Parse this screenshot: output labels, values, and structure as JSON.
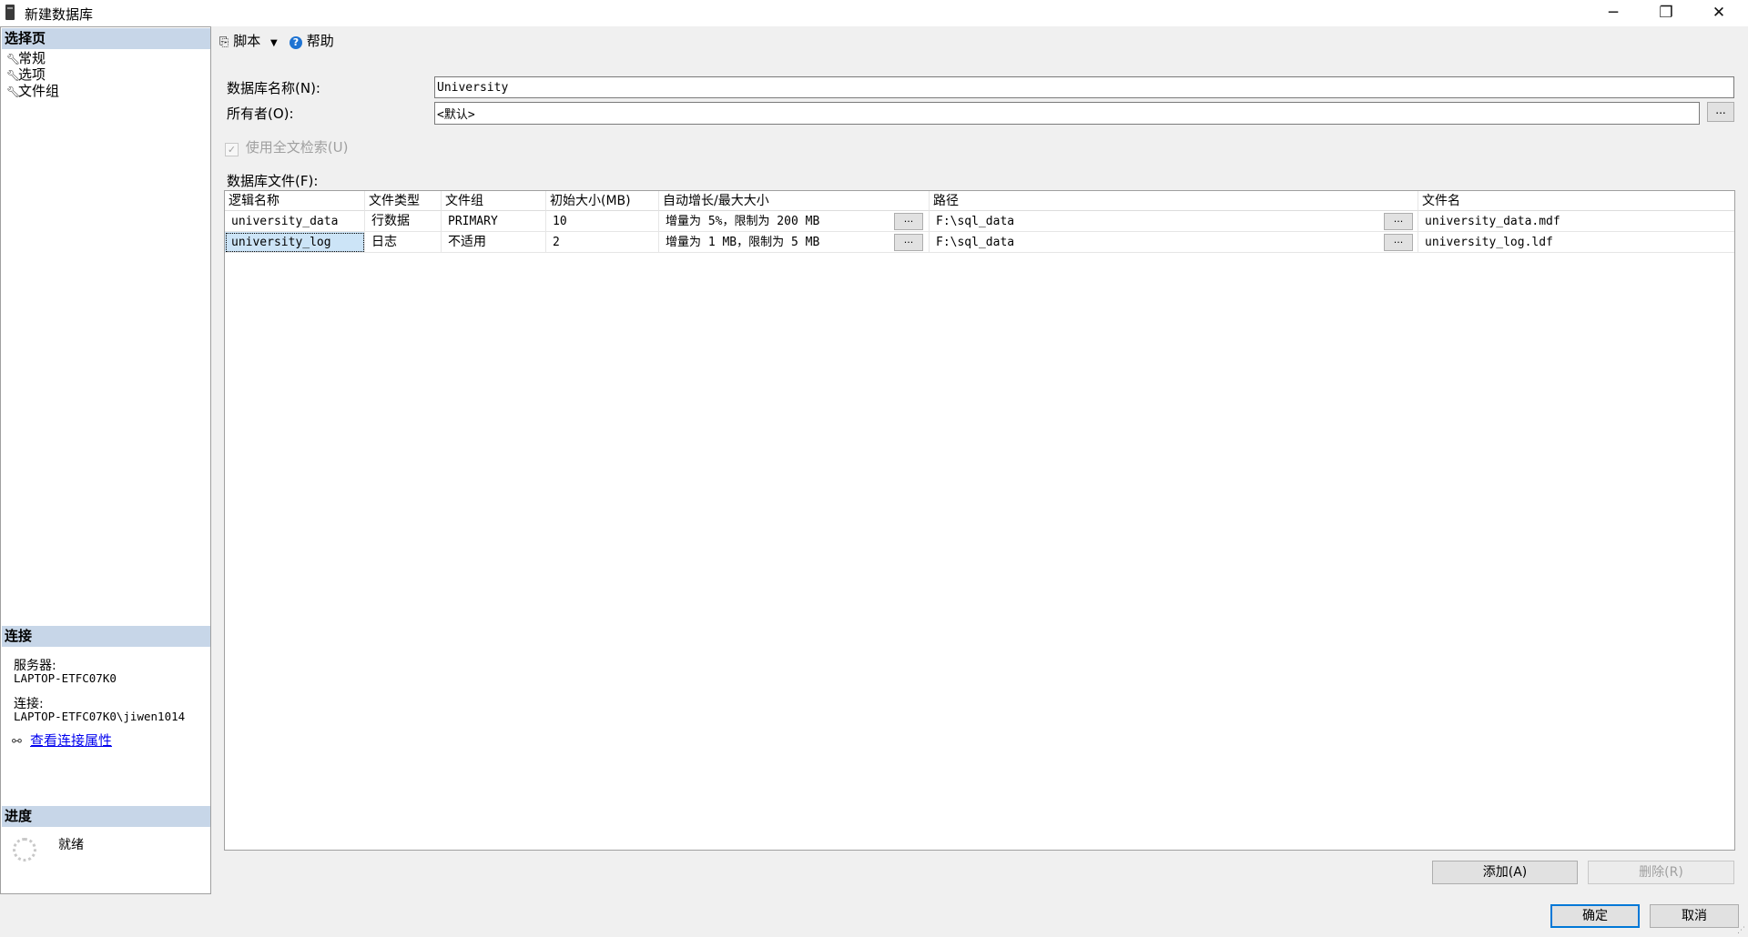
{
  "window": {
    "title": "新建数据库",
    "minimize": "─",
    "restore": "❐",
    "close": "✕"
  },
  "sidebar": {
    "select_page_header": "选择页",
    "pages": [
      {
        "label": "常规",
        "icon": "wrench-icon"
      },
      {
        "label": "选项",
        "icon": "wrench-icon"
      },
      {
        "label": "文件组",
        "icon": "wrench-icon"
      }
    ],
    "connection_header": "连接",
    "server_label": "服务器:",
    "server_value": "LAPTOP-ETFC07K0",
    "connection_label": "连接:",
    "connection_value": "LAPTOP-ETFC07K0\\jiwen1014",
    "view_properties_link": "查看连接属性",
    "progress_header": "进度",
    "progress_status": "就绪"
  },
  "toolbar": {
    "script_label": "脚本",
    "help_label": "帮助"
  },
  "form": {
    "db_name_label": "数据库名称(N):",
    "db_name_value": "University",
    "owner_label": "所有者(O):",
    "owner_value": "<默认>",
    "owner_browse": "...",
    "fulltext_label": "使用全文检索(U)",
    "fulltext_checked": true,
    "db_files_label": "数据库文件(F):"
  },
  "files_table": {
    "columns": [
      "逻辑名称",
      "文件类型",
      "文件组",
      "初始大小(MB)",
      "自动增长/最大大小",
      "路径",
      "文件名"
    ],
    "rows": [
      {
        "logical_name": "university_data",
        "file_type": "行数据",
        "filegroup": "PRIMARY",
        "initial_size": "10",
        "autogrowth": "增量为 5%，限制为 200 MB",
        "autogrowth_btn": "...",
        "path": "F:\\sql_data",
        "path_btn": "...",
        "file_name": "university_data.mdf"
      },
      {
        "logical_name": "university_log",
        "file_type": "日志",
        "filegroup": "不适用",
        "initial_size": "2",
        "autogrowth": "增量为 1 MB，限制为 5 MB",
        "autogrowth_btn": "...",
        "path": "F:\\sql_data",
        "path_btn": "...",
        "file_name": "university_log.ldf"
      }
    ]
  },
  "buttons": {
    "add": "添加(A)",
    "remove": "删除(R)",
    "ok": "确定",
    "cancel": "取消"
  },
  "colors": {
    "section_header_bg": "#c7d6e8",
    "selection_bg": "#cce4f7",
    "accent": "#0078d7"
  }
}
